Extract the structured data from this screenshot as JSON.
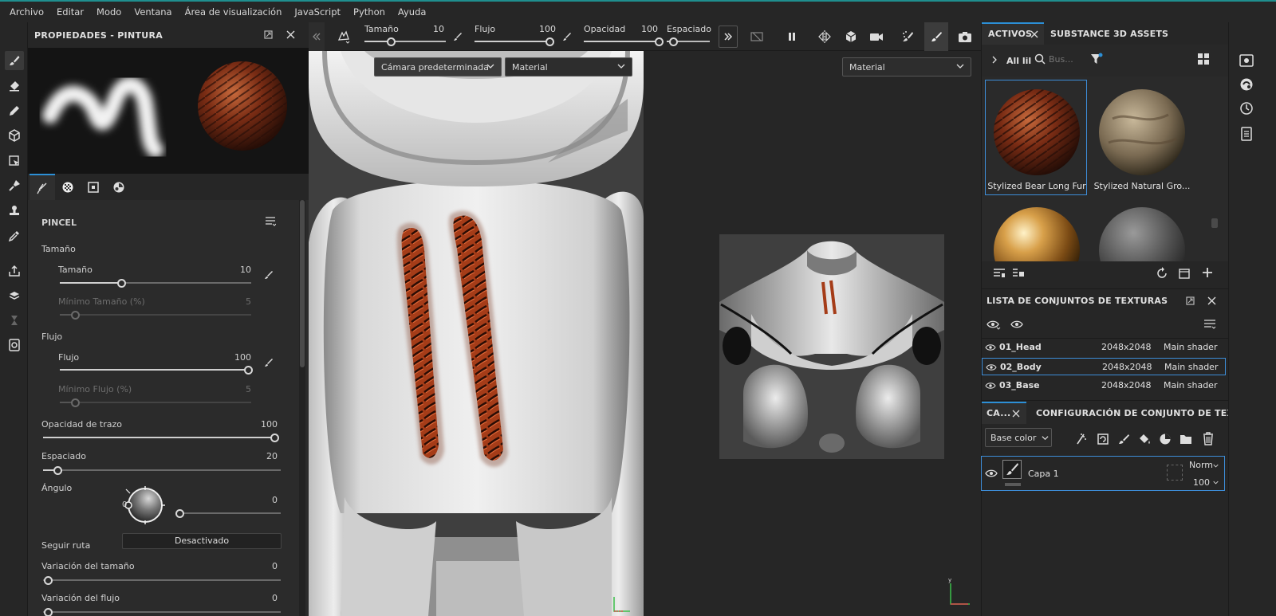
{
  "menu": [
    "Archivo",
    "Editar",
    "Modo",
    "Ventana",
    "Área de visualización",
    "JavaScript",
    "Python",
    "Ayuda"
  ],
  "properties_panel": {
    "title": "PROPIEDADES - PINTURA",
    "section": "PINCEL",
    "groups": {
      "size_group": "Tamaño",
      "flow_group": "Flujo"
    },
    "size": {
      "label": "Tamaño",
      "value": "10",
      "fraction": 0.32
    },
    "min_size": {
      "label": "Mínimo Tamaño (%)",
      "value": "5",
      "fraction": 0.08
    },
    "flow": {
      "label": "Flujo",
      "value": "100",
      "fraction": 1.0
    },
    "min_flow": {
      "label": "Mínimo Flujo (%)",
      "value": "5",
      "fraction": 0.08
    },
    "stroke_opacity": {
      "label": "Opacidad de trazo",
      "value": "100",
      "fraction": 1.0
    },
    "spacing": {
      "label": "Espaciado",
      "value": "20",
      "fraction": 0.06
    },
    "angle": {
      "label": "Ángulo",
      "value": "0",
      "dial_zero": "0",
      "fraction": 0.0
    },
    "follow_path": {
      "label": "Seguir ruta",
      "value": "Desactivado"
    },
    "size_variation": {
      "label": "Variación del tamaño",
      "value": "0",
      "fraction": 0.0
    },
    "flow_variation": {
      "label": "Variación del flujo",
      "value": "0",
      "fraction": 0.0
    }
  },
  "toolbar": {
    "size": {
      "label": "Tamaño",
      "value": "10",
      "fraction": 0.32
    },
    "flow": {
      "label": "Flujo",
      "value": "100",
      "fraction": 1.0
    },
    "opacity": {
      "label": "Opacidad",
      "value": "100",
      "fraction": 1.0
    },
    "spacing": {
      "label": "Espaciado",
      "fraction": 0.06
    }
  },
  "viewport3d": {
    "camera": "Cámara predeterminada",
    "mode": "Material"
  },
  "viewport2d": {
    "mode": "Material"
  },
  "assets": {
    "tab_active": "ACTIVOS",
    "tab_other": "SUBSTANCE 3D ASSETS",
    "breadcrumb": "All lil",
    "search_placeholder": "Bus...",
    "items": [
      {
        "name": "Stylized Bear Long Fur",
        "selected": true
      },
      {
        "name": "Stylized Natural Gro..."
      },
      {
        "name": ""
      },
      {
        "name": ""
      }
    ]
  },
  "texture_sets": {
    "title": "LISTA DE CONJUNTOS DE TEXTURAS",
    "rows": [
      {
        "name": "01_Head",
        "res": "2048x2048",
        "shader": "Main shader"
      },
      {
        "name": "02_Body",
        "res": "2048x2048",
        "shader": "Main shader",
        "selected": true
      },
      {
        "name": "03_Base",
        "res": "2048x2048",
        "shader": "Main shader"
      }
    ]
  },
  "layers": {
    "tab_active": "CA...",
    "tab_other": "CONFIGURACIÓN DE CONJUNTO DE TEXTU...",
    "channel": "Base color",
    "items": [
      {
        "name": "Capa 1",
        "blend": "Norm",
        "opacity": "100"
      }
    ]
  },
  "axis": {
    "x": "x",
    "y": "y",
    "z": "z"
  },
  "colors": {
    "accent": "#2c8fd6",
    "teal_top": "#1f8f8f",
    "fur": "#b4441c"
  }
}
